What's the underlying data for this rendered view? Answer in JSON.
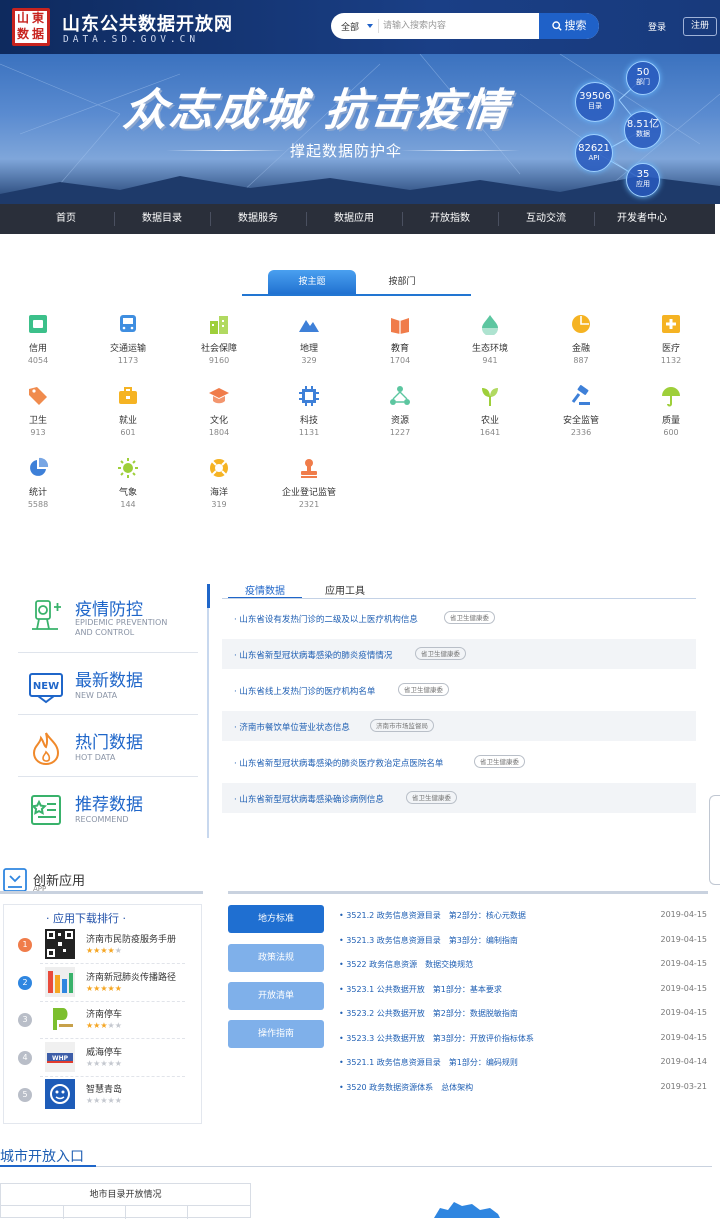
{
  "header": {
    "site_title": "山东公共数据开放网",
    "site_domain": "DATA.SD.GOV.CN",
    "logo_text": [
      "山",
      "東",
      "数",
      "据"
    ],
    "search_scope": "全部",
    "search_placeholder": "请输入搜索内容",
    "search_button": "搜索",
    "login": "登录",
    "register": "注册"
  },
  "banner": {
    "slogan": "众志成城 抗击疫情",
    "subslogan": "撑起数据防护伞",
    "stats": [
      {
        "value": "50",
        "label": "部门"
      },
      {
        "value": "39506",
        "label": "目录"
      },
      {
        "value": "8.51亿",
        "label": "数据"
      },
      {
        "value": "82621",
        "label": "API"
      },
      {
        "value": "35",
        "label": "应用"
      }
    ]
  },
  "nav": [
    "首页",
    "数据目录",
    "数据服务",
    "数据应用",
    "开放指数",
    "互动交流",
    "开发者中心"
  ],
  "category_tabs": {
    "active": "按主题",
    "other": "按部门"
  },
  "categories": [
    {
      "name": "信用",
      "count": "4054",
      "color": "#3cc08a",
      "icon": "credit-card-icon"
    },
    {
      "name": "交通运输",
      "count": "1173",
      "color": "#3f8ee0",
      "icon": "bus-icon"
    },
    {
      "name": "社会保障",
      "count": "9160",
      "color": "#9ecf3a",
      "icon": "buildings-icon"
    },
    {
      "name": "地理",
      "count": "329",
      "color": "#3e80d8",
      "icon": "mountain-icon"
    },
    {
      "name": "教育",
      "count": "1704",
      "color": "#f07c4a",
      "icon": "book-icon"
    },
    {
      "name": "生态环境",
      "count": "941",
      "color": "#5cc6a0",
      "icon": "water-drop-icon"
    },
    {
      "name": "金融",
      "count": "887",
      "color": "#f5b323",
      "icon": "pie-coin-icon"
    },
    {
      "name": "医疗",
      "count": "1132",
      "color": "#f5b323",
      "icon": "medical-cross-icon"
    },
    {
      "name": "卫生",
      "count": "913",
      "color": "#f08b4d",
      "icon": "tag-icon"
    },
    {
      "name": "就业",
      "count": "601",
      "color": "#f5b323",
      "icon": "briefcase-icon"
    },
    {
      "name": "文化",
      "count": "1804",
      "color": "#f07c4a",
      "icon": "graduation-cap-icon"
    },
    {
      "name": "科技",
      "count": "1131",
      "color": "#3e80d8",
      "icon": "chip-icon"
    },
    {
      "name": "资源",
      "count": "1227",
      "color": "#5cc6a0",
      "icon": "network-icon"
    },
    {
      "name": "农业",
      "count": "1641",
      "color": "#9ecf3a",
      "icon": "sprout-icon"
    },
    {
      "name": "安全监管",
      "count": "2336",
      "color": "#3e80d8",
      "icon": "gavel-icon"
    },
    {
      "name": "质量",
      "count": "600",
      "color": "#9ecf3a",
      "icon": "umbrella-icon"
    },
    {
      "name": "统计",
      "count": "5588",
      "color": "#3e80d8",
      "icon": "pie-chart-icon"
    },
    {
      "name": "气象",
      "count": "144",
      "color": "#9ecf3a",
      "icon": "sun-icon"
    },
    {
      "name": "海洋",
      "count": "319",
      "color": "#f5b323",
      "icon": "lifebuoy-icon"
    },
    {
      "name": "企业登记监管",
      "count": "2321",
      "color": "#f07c4a",
      "icon": "stamp-icon"
    }
  ],
  "features": [
    {
      "title": "疫情防控",
      "en1": "EPIDEMIC PREVENTION",
      "en2": "AND CONTROL",
      "icon": "epidemic-control-icon"
    },
    {
      "title": "最新数据",
      "en1": "NEW DATA",
      "en2": "",
      "icon": "new-badge-icon"
    },
    {
      "title": "热门数据",
      "en1": "HOT DATA",
      "en2": "",
      "icon": "flame-icon"
    },
    {
      "title": "推荐数据",
      "en1": "RECOMMEND",
      "en2": "",
      "icon": "recommend-icon"
    }
  ],
  "epidemic_tabs": [
    "疫情数据",
    "应用工具"
  ],
  "epidemic_items": [
    {
      "text": "山东省设有发热门诊的二级及以上医疗机构信息",
      "tag": "省卫生健康委"
    },
    {
      "text": "山东省新型冠状病毒感染的肺炎疫情情况",
      "tag": "省卫生健康委"
    },
    {
      "text": "山东省线上发热门诊的医疗机构名单",
      "tag": "省卫生健康委"
    },
    {
      "text": "济南市餐饮单位营业状态信息",
      "tag": "济南市市场监督局"
    },
    {
      "text": "山东省新型冠状病毒感染的肺炎医疗救治定点医院名单",
      "tag": "省卫生健康委"
    },
    {
      "text": "山东省新型冠状病毒感染确诊病例信息",
      "tag": "省卫生健康委"
    }
  ],
  "innovation": {
    "title": "创新应用",
    "subtitle": "APP",
    "rank_title": "· 应用下载排行 ·",
    "apps": [
      {
        "rank": "1",
        "name": "济南市民防疫服务手册",
        "stars": 4,
        "rank_color": "#f07c4a"
      },
      {
        "rank": "2",
        "name": "济南新冠肺炎传播路径",
        "stars": 5,
        "rank_color": "#2f86e0"
      },
      {
        "rank": "3",
        "name": "济南停车",
        "stars": 3,
        "rank_color": "#b9bec8"
      },
      {
        "rank": "4",
        "name": "威海停车",
        "stars": 0,
        "rank_color": "#b9bec8"
      },
      {
        "rank": "5",
        "name": "智慧青岛",
        "stars": 0,
        "rank_color": "#b9bec8"
      }
    ]
  },
  "standards": {
    "buttons": [
      "地方标准",
      "政策法规",
      "开放清单",
      "操作指南"
    ],
    "rows": [
      {
        "text": "3521.2 政务信息资源目录　第2部分：核心元数据",
        "date": "2019-04-15"
      },
      {
        "text": "3521.3 政务信息资源目录　第3部分：编制指南",
        "date": "2019-04-15"
      },
      {
        "text": "3522 政务信息资源　数据交换规范",
        "date": "2019-04-15"
      },
      {
        "text": "3523.1 公共数据开放　第1部分：基本要求",
        "date": "2019-04-15"
      },
      {
        "text": "3523.2 公共数据开放　第2部分：数据脱敏指南",
        "date": "2019-04-15"
      },
      {
        "text": "3523.3 公共数据开放　第3部分：开放评价指标体系",
        "date": "2019-04-15"
      },
      {
        "text": "3521.1 政务信息资源目录　第1部分：编码规则",
        "date": "2019-04-14"
      },
      {
        "text": "3520 政务数据资源体系　总体架构",
        "date": "2019-03-21"
      }
    ]
  },
  "city": {
    "title": "城市开放入口",
    "table_header": "地市目录开放情况"
  }
}
